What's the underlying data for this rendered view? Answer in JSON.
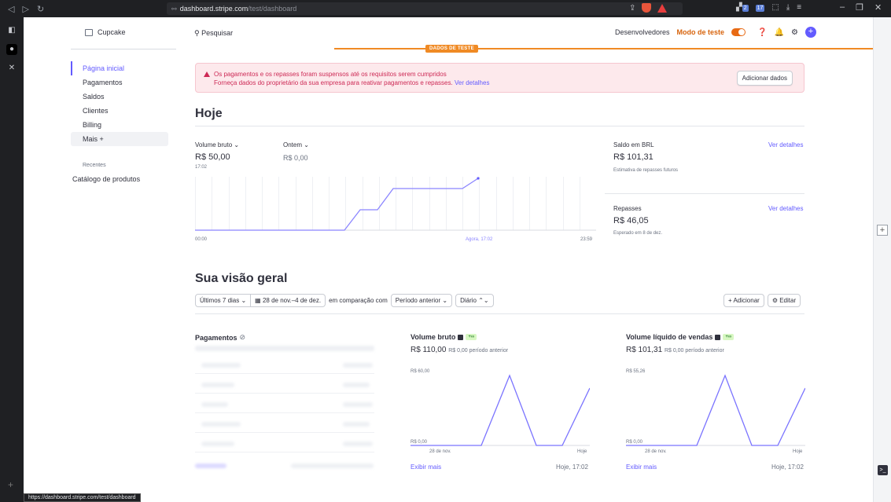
{
  "browser": {
    "url_host": "dashboard.stripe.com",
    "url_path": "/test/dashboard",
    "status_url": "https://dashboard.stripe.com/test/dashboard",
    "ext_badge_1": "2",
    "ext_badge_2": "17"
  },
  "header": {
    "account_name": "Cupcake",
    "search_placeholder": "Pesquisar",
    "developers": "Desenvolvedores",
    "test_mode": "Modo de teste",
    "test_data_badge": "DADOS DE TESTE"
  },
  "sidebar": {
    "items": [
      {
        "label": "Página inicial"
      },
      {
        "label": "Pagamentos"
      },
      {
        "label": "Saldos"
      },
      {
        "label": "Clientes"
      },
      {
        "label": "Billing"
      },
      {
        "label": "Mais +"
      }
    ],
    "recent_title": "Recentes",
    "recent_item": "Catálogo de produtos"
  },
  "alert": {
    "title": "Os pagamentos e os repasses foram suspensos até os requisitos serem cumpridos",
    "text": "Forneça dados do proprietário da sua empresa para reativar pagamentos e repasses.",
    "link": "Ver detalhes",
    "button": "Adicionar dados"
  },
  "today": {
    "title": "Hoje",
    "gross_label": "Volume bruto ⌄",
    "gross_value": "R$ 50,00",
    "gross_time": "17:02",
    "yesterday_label": "Ontem ⌄",
    "yesterday_value": "R$ 0,00",
    "axis_start": "00:00",
    "axis_now": "Agora, 17:02",
    "axis_end": "23:59",
    "balance_title": "Saldo em BRL",
    "balance_link": "Ver detalhes",
    "balance_value": "R$ 101,31",
    "balance_sub": "Estimativa de repasses futuros",
    "payouts_title": "Repasses",
    "payouts_link": "Ver detalhes",
    "payouts_value": "R$ 46,05",
    "payouts_sub": "Esperado em 8 de dez."
  },
  "overview": {
    "title": "Sua visão geral",
    "range": "Últimos 7 dias ⌄",
    "dates": "28 de nov.–4 de dez.",
    "compare_text": "em comparação com",
    "compare_select": "Período anterior ⌄",
    "interval": "Diário ⌃⌄",
    "add_button": "+ Adicionar",
    "edit_button": "⚙ Editar",
    "payments_title": "Pagamentos",
    "gross": {
      "title": "Volume bruto",
      "badge": "+∞",
      "value": "R$ 110,00",
      "prev": "R$ 0,00 período anterior",
      "y_top": "R$ 60,00",
      "y_bottom": "R$ 0,00",
      "x_start": "28 de nov.",
      "x_end": "Hoje",
      "link": "Exibir mais",
      "time": "Hoje, 17:02"
    },
    "net": {
      "title": "Volume líquido de vendas",
      "badge": "+∞",
      "value": "R$ 101,31",
      "prev": "R$ 0,00 período anterior",
      "y_top": "R$ 55,26",
      "y_bottom": "R$ 0,00",
      "x_start": "28 de nov.",
      "x_end": "Hoje",
      "link": "Exibir mais",
      "time": "Hoje, 17:02"
    }
  },
  "colors": {
    "accent": "#635bff",
    "test_orange": "#f08a24",
    "alert_red": "#cd2955"
  }
}
